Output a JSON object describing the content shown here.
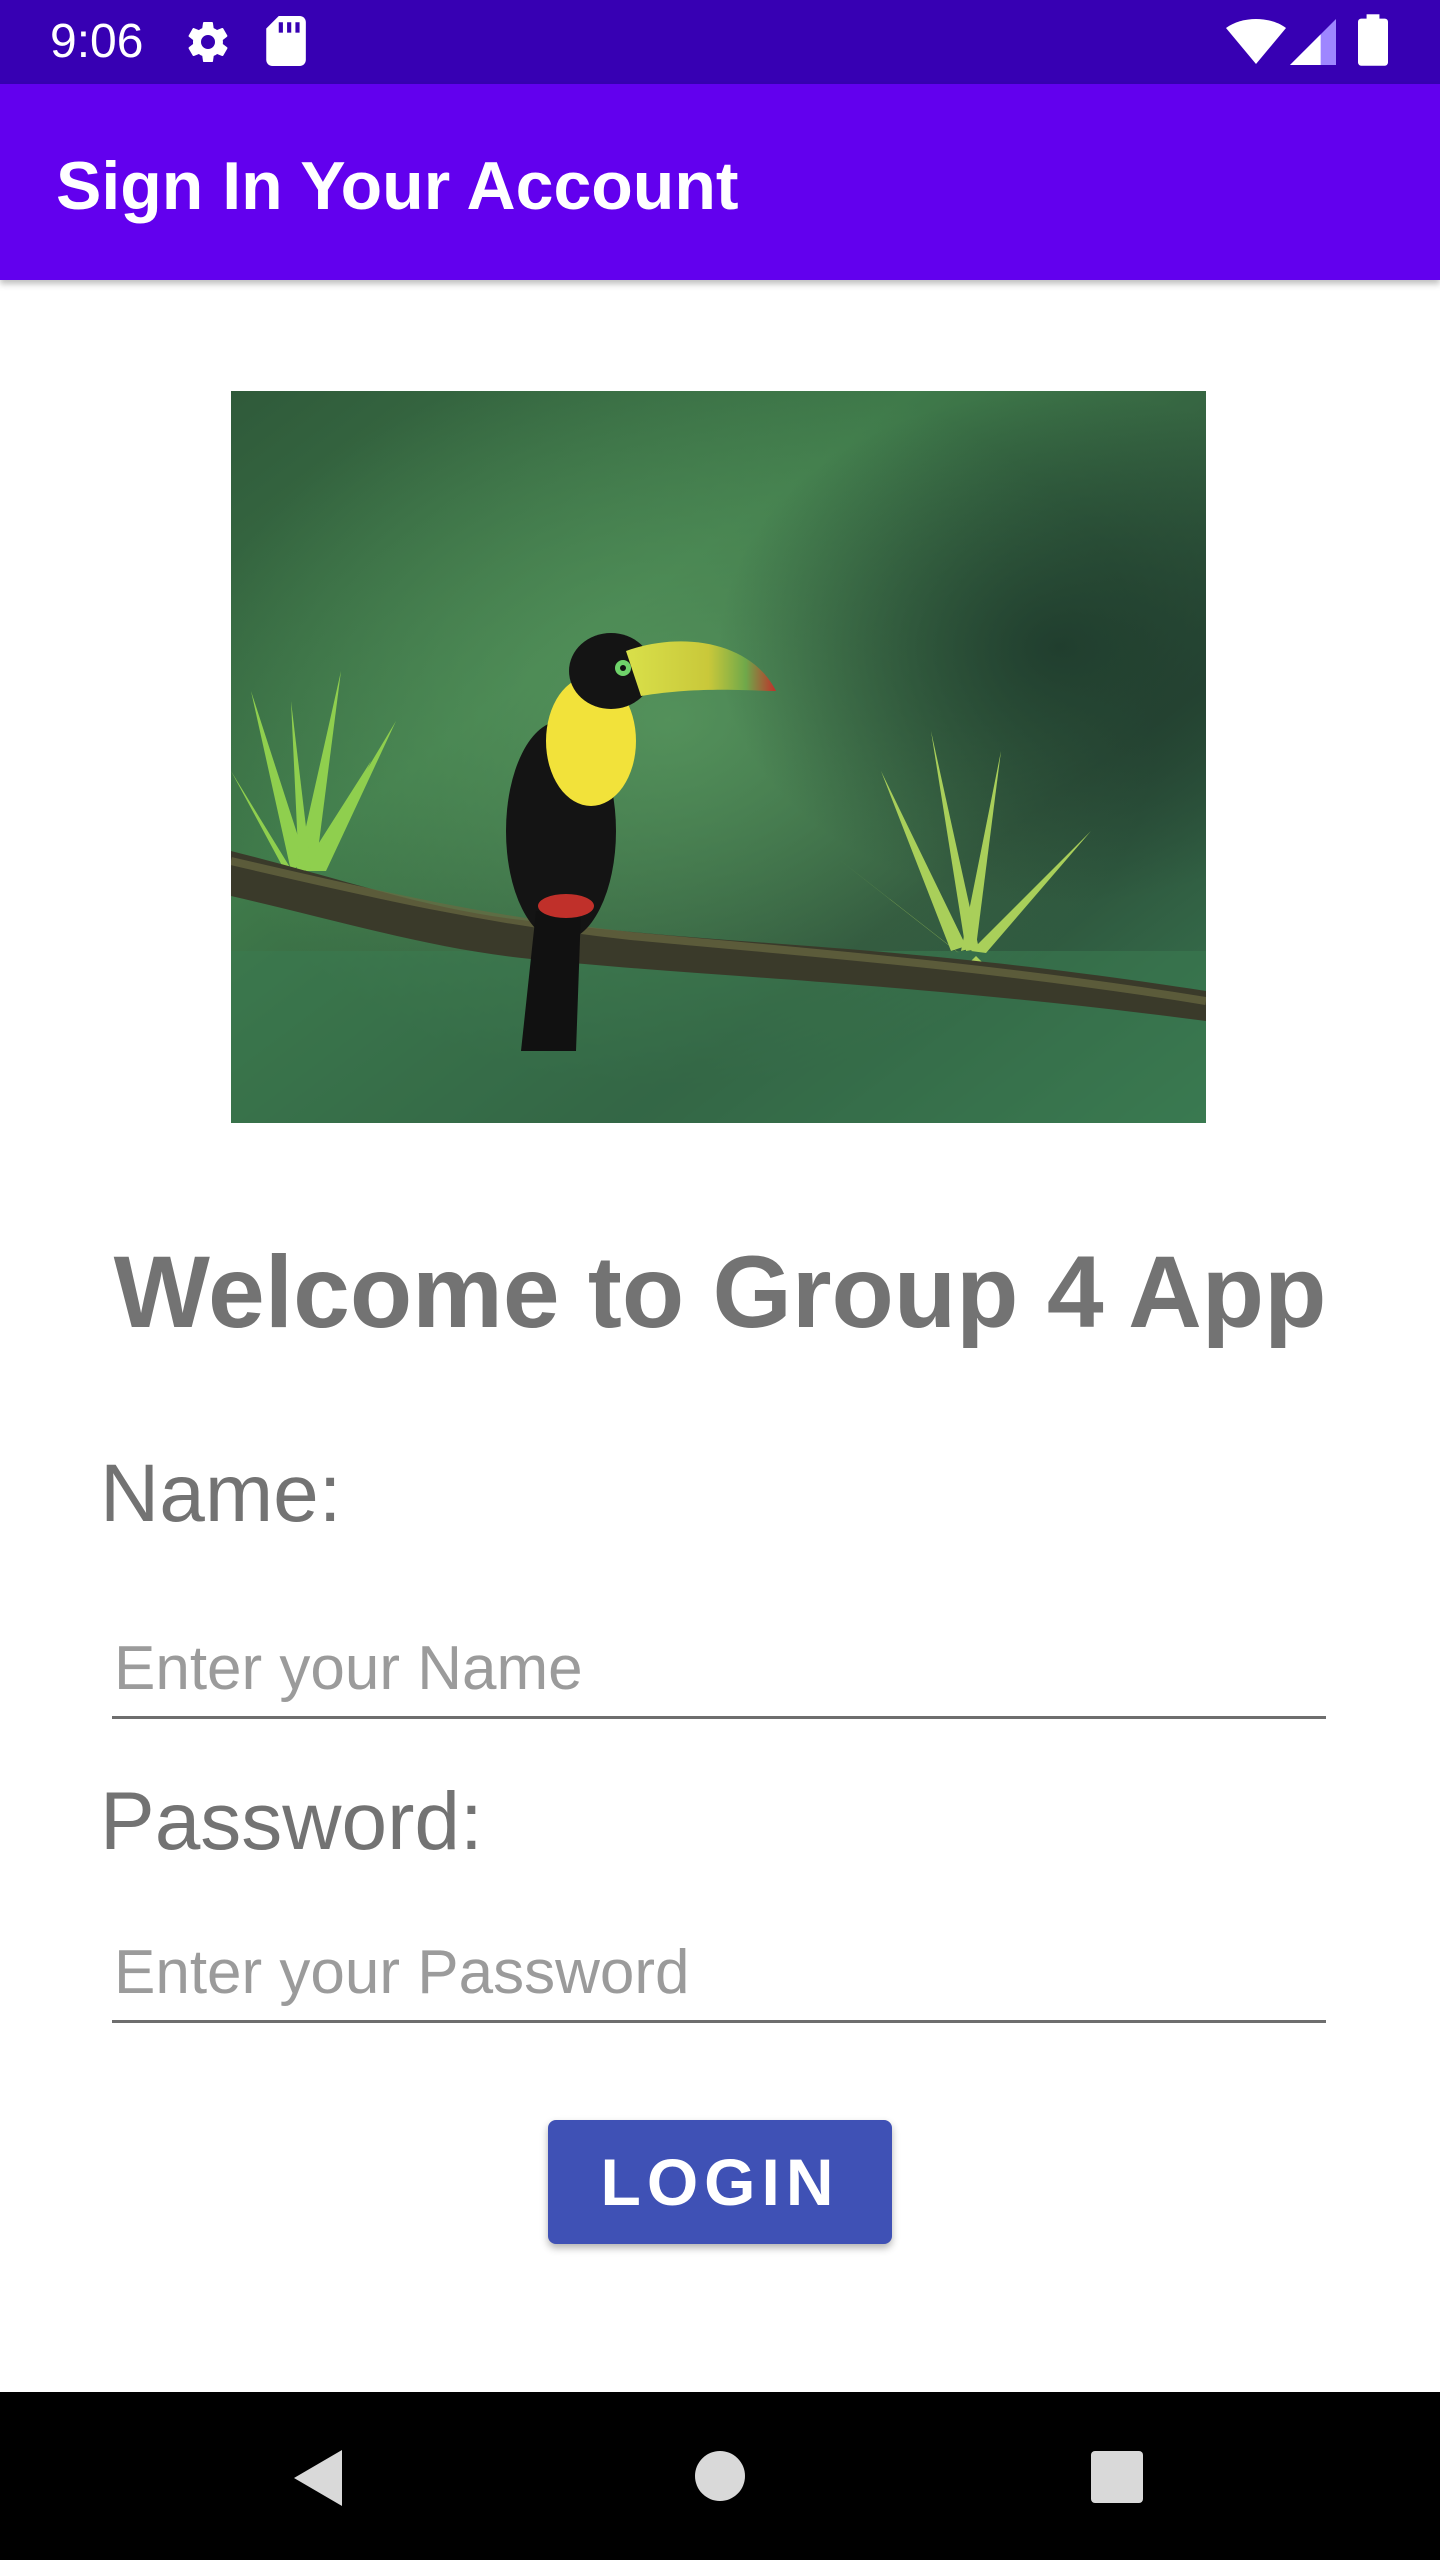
{
  "status_bar": {
    "time": "9:06",
    "icons": [
      "gear-icon",
      "sd-card-icon",
      "wifi-icon",
      "signal-icon",
      "battery-icon"
    ]
  },
  "app_bar": {
    "title": "Sign In Your Account",
    "color": "#6200ee"
  },
  "hero": {
    "subject": "toucan-on-branch-image"
  },
  "main": {
    "welcome": "Welcome to Group 4 App",
    "name_label": "Name:",
    "name_placeholder": "Enter your Name",
    "password_label": "Password:",
    "password_placeholder": "Enter your Password",
    "login_label": "LOGIN",
    "button_color": "#3f51b5"
  },
  "nav_bar": {
    "icons": [
      "back-icon",
      "home-icon",
      "recents-icon"
    ]
  }
}
